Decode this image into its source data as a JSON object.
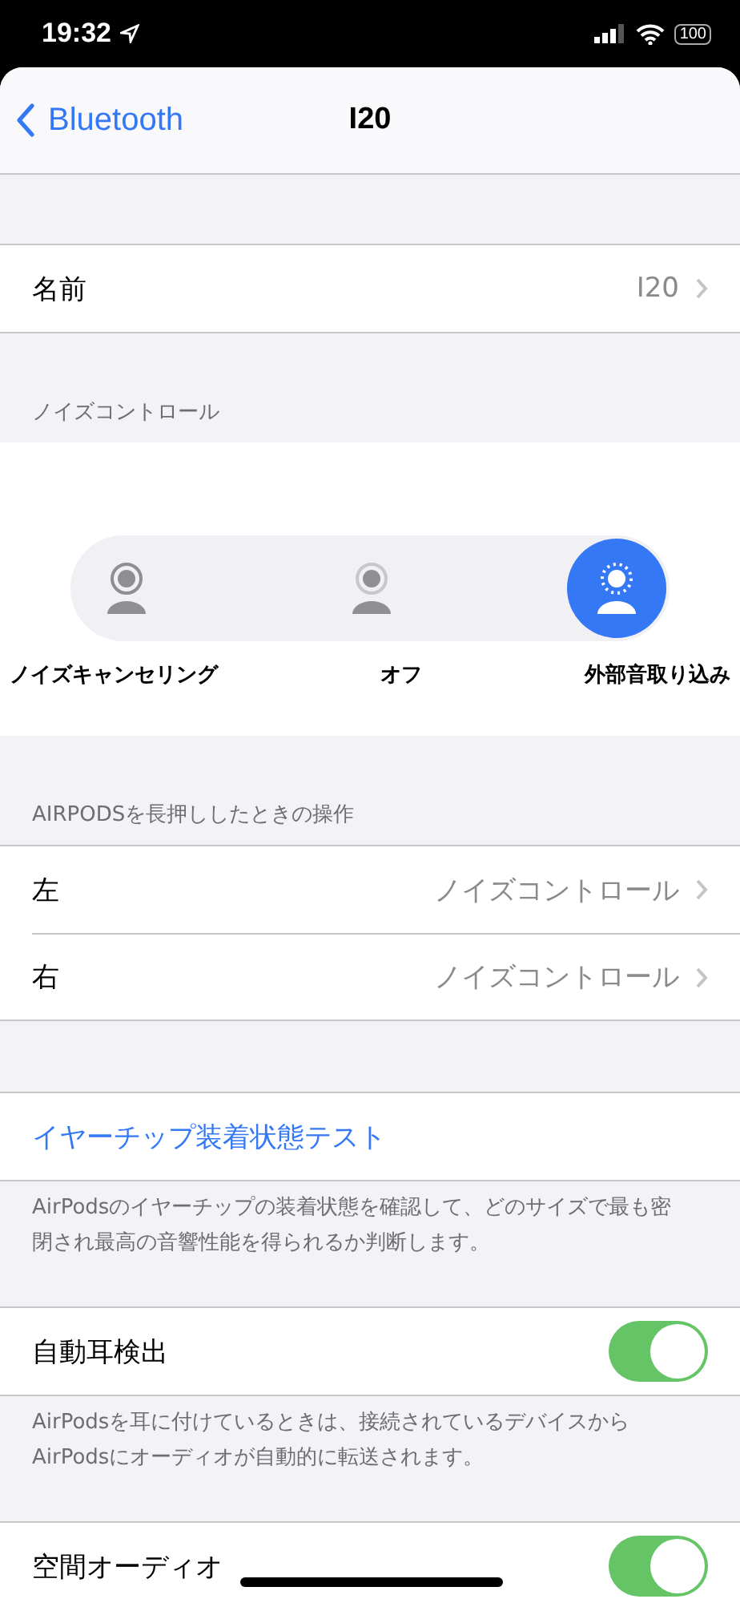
{
  "status_bar": {
    "time": "19:32",
    "battery": "100"
  },
  "nav": {
    "back": "Bluetooth",
    "title": "I20"
  },
  "name_row": {
    "label": "名前",
    "value": "I20"
  },
  "noise_control": {
    "header": "ノイズコントロール",
    "modes": [
      {
        "label": "ノイズキャンセリング",
        "kind": "cancel",
        "selected": false
      },
      {
        "label": "オフ",
        "kind": "off",
        "selected": false
      },
      {
        "label": "外部音取り込み",
        "kind": "transparency",
        "selected": true
      }
    ]
  },
  "press_hold": {
    "header": "AIRPODSを長押ししたときの操作",
    "rows": [
      {
        "label": "左",
        "value": "ノイズコントロール"
      },
      {
        "label": "右",
        "value": "ノイズコントロール"
      }
    ]
  },
  "eartip": {
    "link": "イヤーチップ装着状態テスト",
    "footer": "AirPodsのイヤーチップの装着状態を確認して、どのサイズで最も密閉され最高の音響性能を得られるか判断します。"
  },
  "toggles": [
    {
      "label": "自動耳検出",
      "on": true,
      "footer": "AirPodsを耳に付けているときは、接続されているデバイスからAirPodsにオーディオが自動的に転送されます。"
    },
    {
      "label": "空間オーディオ",
      "on": true
    }
  ]
}
